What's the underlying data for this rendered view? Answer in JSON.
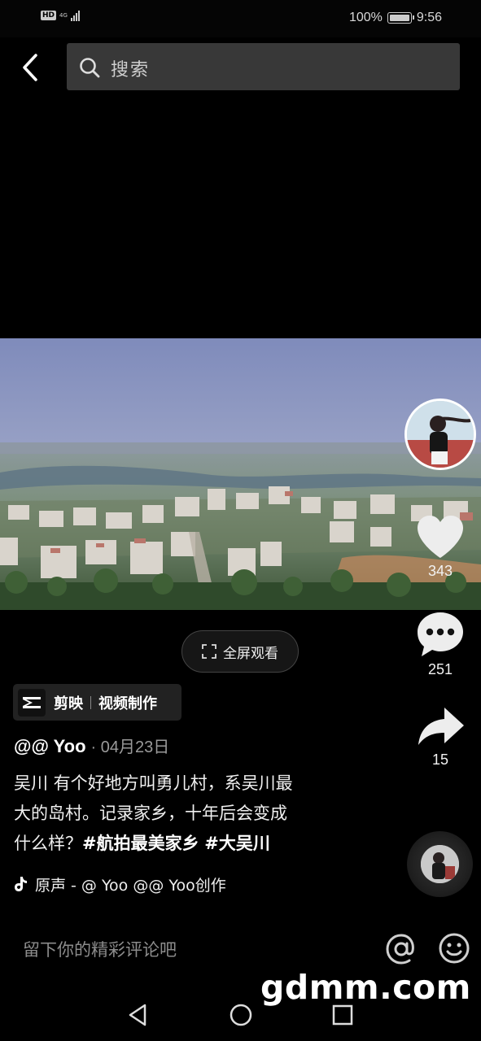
{
  "status_bar": {
    "hd": "HD",
    "network": "4G",
    "battery_percent": "100%",
    "time": "9:56"
  },
  "search": {
    "placeholder": "搜索"
  },
  "post": {
    "like_count": "343",
    "comment_count": "251",
    "share_count": "15",
    "fullscreen_label": "全屏观看",
    "capcut_name": "剪映",
    "capcut_desc": "视频制作",
    "author": "@@ Yoo",
    "date": "· 04月23日",
    "caption_line1": "吴川 有个好地方叫勇儿村，系吴川最",
    "caption_line2": "大的岛村。记录家乡，十年后会变成",
    "caption_line3_prefix": "什么样？",
    "hashtags": [
      "#航拍最美家乡",
      "#大吴川"
    ],
    "music_text": "原声 - @ Yoo    @@ Yoo创作"
  },
  "comment": {
    "placeholder": "留下你的精彩评论吧"
  },
  "watermark": "gdmm.com",
  "colors": {
    "background": "#000000",
    "search_box": "#383838",
    "muted_text": "#9a9a9a"
  }
}
